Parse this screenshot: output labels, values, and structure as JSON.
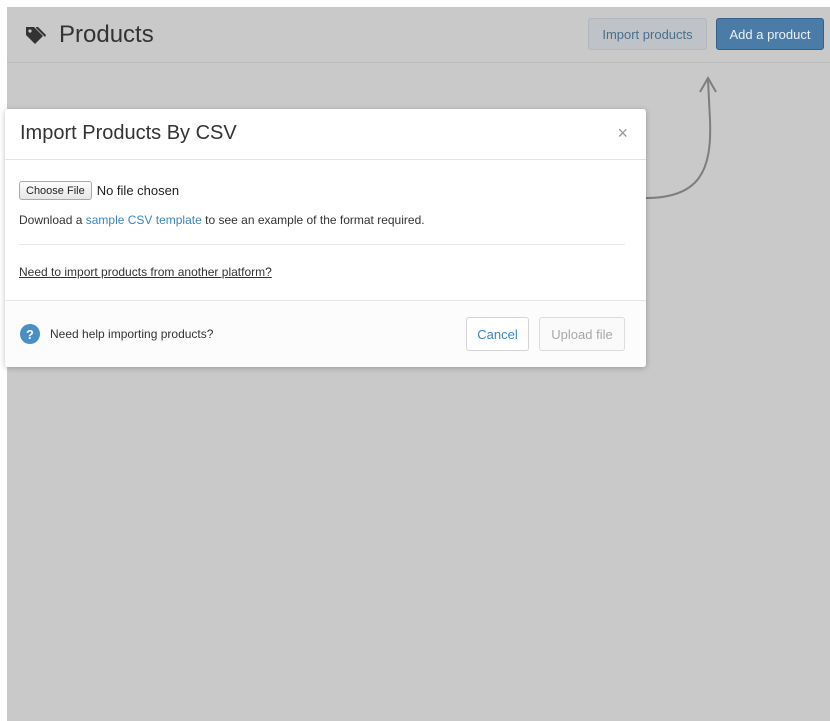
{
  "header": {
    "title": "Products",
    "title_icon": "tag-icon",
    "import_label": "Import products",
    "add_label": "Add a product"
  },
  "modal": {
    "title": "Import Products By CSV",
    "close_symbol": "×",
    "choose_file_label": "Choose File",
    "file_status": "No file chosen",
    "download_prefix": "Download a ",
    "download_link": "sample CSV template",
    "download_suffix": " to see an example of the format required.",
    "other_platform_link": "Need to import products from another platform?",
    "help_icon_glyph": "?",
    "help_text": "Need help importing products?",
    "cancel_label": "Cancel",
    "upload_label": "Upload file"
  },
  "colors": {
    "overlay": "#c9c9c9",
    "primary": "#4b7ca8",
    "link": "#3b85bd",
    "help_icon": "#4a8fc4"
  }
}
